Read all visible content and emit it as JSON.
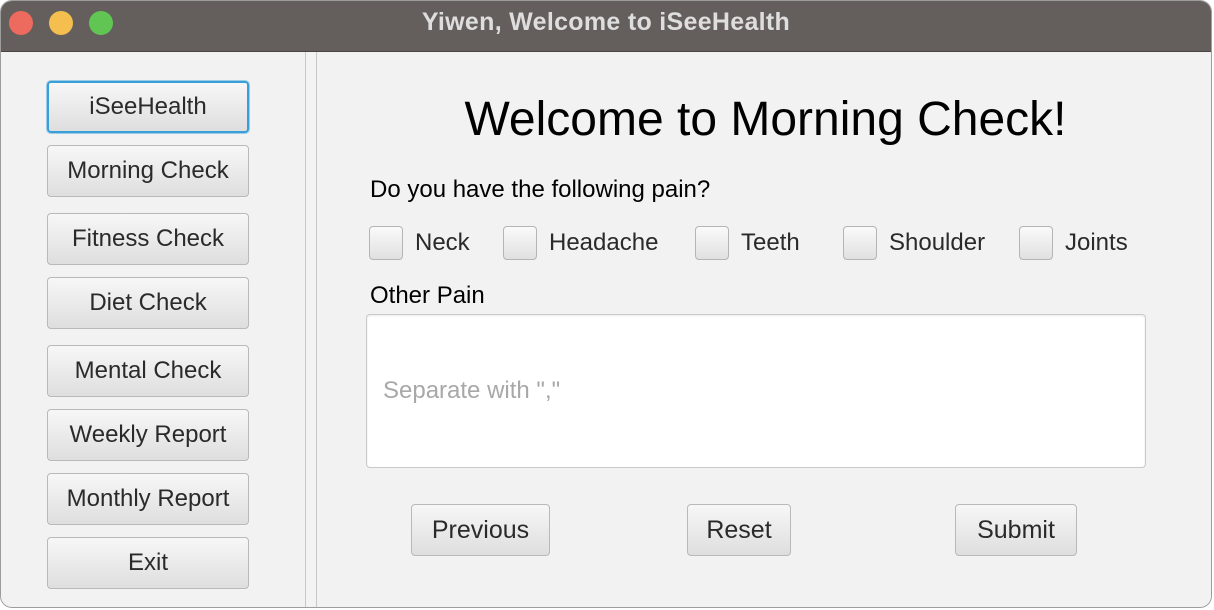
{
  "window": {
    "title": "Yiwen, Welcome to iSeeHealth"
  },
  "sidebar": {
    "items": [
      {
        "label": "iSeeHealth",
        "active": true
      },
      {
        "label": "Morning Check",
        "active": false
      },
      {
        "label": "Fitness Check",
        "active": false
      },
      {
        "label": "Diet Check",
        "active": false
      },
      {
        "label": "Mental Check",
        "active": false
      },
      {
        "label": "Weekly Report",
        "active": false
      },
      {
        "label": "Monthly Report",
        "active": false
      },
      {
        "label": "Exit",
        "active": false
      }
    ]
  },
  "main": {
    "heading": "Welcome to Morning Check!",
    "question": "Do you have the following pain?",
    "pain_options": [
      {
        "label": "Neck",
        "checked": false
      },
      {
        "label": "Headache",
        "checked": false
      },
      {
        "label": "Teeth",
        "checked": false
      },
      {
        "label": "Shoulder",
        "checked": false
      },
      {
        "label": "Joints",
        "checked": false
      }
    ],
    "other_pain_label": "Other Pain",
    "other_pain_value": "",
    "other_pain_placeholder": "Separate with \",\"",
    "buttons": {
      "previous": "Previous",
      "reset": "Reset",
      "submit": "Submit"
    }
  },
  "colors": {
    "titlebar": "#645e5d",
    "title_text": "#dedede",
    "focus_ring": "#3a9fd6",
    "close": "#ed6a5e",
    "minimize": "#f5bf4f",
    "maximize": "#61c554"
  }
}
